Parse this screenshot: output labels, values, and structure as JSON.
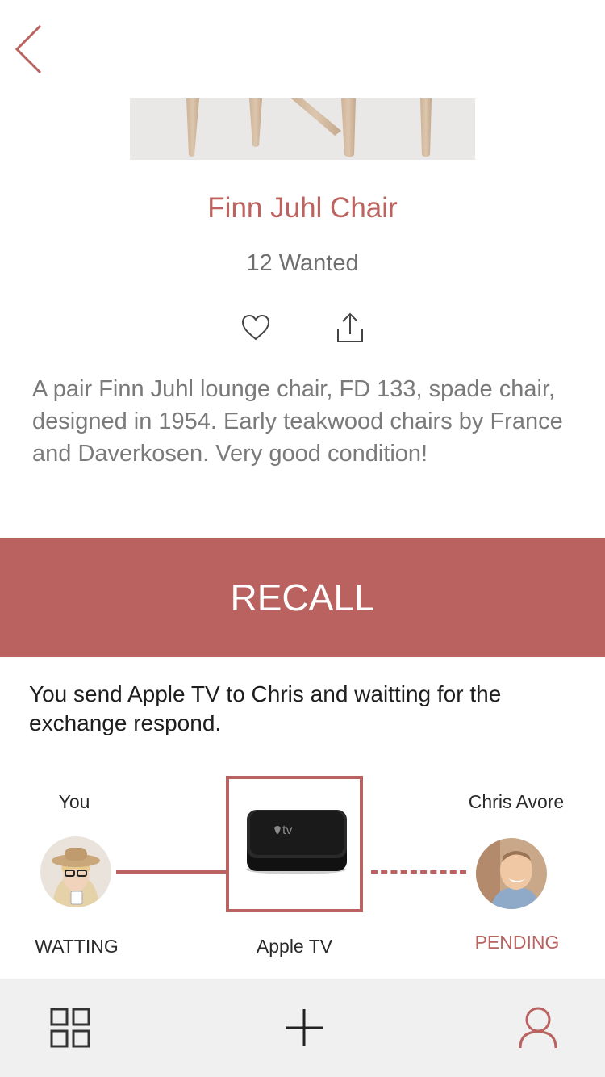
{
  "product": {
    "title": "Finn Juhl Chair",
    "wanted": "12 Wanted",
    "description": "A pair Finn Juhl lounge chair, FD 133, spade chair, designed in 1954. Early teakwood chairs by France and Daverkosen. Very good condition!"
  },
  "actions": {
    "recall_label": "RECALL"
  },
  "exchange": {
    "message": "You send Apple TV to Chris and waitting for the exchange respond.",
    "you": {
      "name": "You",
      "status": "WATTING"
    },
    "item": {
      "name": "Apple TV",
      "logo_text": "tv"
    },
    "partner": {
      "name": "Chris Avore",
      "status": "PENDING"
    }
  },
  "colors": {
    "accent": "#b9625f",
    "text_dark": "#1e1e1e",
    "text_muted": "#7a7a7a",
    "tabbar_bg": "#f0f0f0"
  },
  "icons": {
    "back": "chevron-left-icon",
    "like": "heart-icon",
    "share": "share-icon",
    "grid": "grid-icon",
    "add": "plus-icon",
    "profile": "user-icon"
  }
}
